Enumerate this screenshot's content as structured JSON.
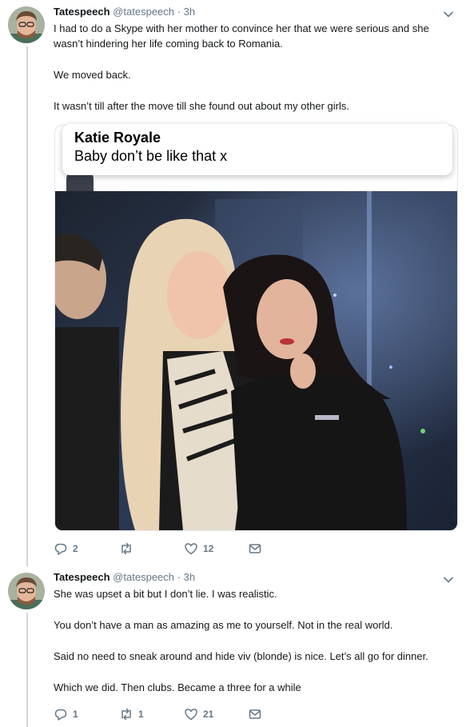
{
  "tweets": [
    {
      "name": "Tatespeech",
      "handle": "@tatespeech",
      "time": "3h",
      "paragraphs": [
        "I had to do a Skype with her mother to convince her that we were serious and she wasn’t hindering her life coming back to Romania.",
        "We moved back.",
        "It wasn’t till after the move till she found out about my other girls."
      ],
      "quote": {
        "name": "Katie Royale",
        "text": "Baby don’t be like that x"
      },
      "actions": {
        "replies": "2",
        "retweets": "",
        "likes": "12"
      }
    },
    {
      "name": "Tatespeech",
      "handle": "@tatespeech",
      "time": "3h",
      "paragraphs": [
        "She was upset a bit but I don’t lie. I was realistic.",
        "You don’t have a man as amazing as me to yourself. Not in the real world.",
        "Said no need to sneak around and hide viv (blonde) is nice. Let’s all go for dinner.",
        "Which we did. Then clubs. Became a three for a while"
      ],
      "actions": {
        "replies": "1",
        "retweets": "1",
        "likes": "21"
      }
    }
  ],
  "icons": {
    "reply": "reply-icon",
    "retweet": "retweet-icon",
    "like": "heart-icon",
    "dm": "envelope-icon",
    "more": "chevron-down-icon"
  },
  "colors": {
    "muted": "#657786",
    "thread_line": "#ccd6dd",
    "border": "#e1e8ed"
  }
}
